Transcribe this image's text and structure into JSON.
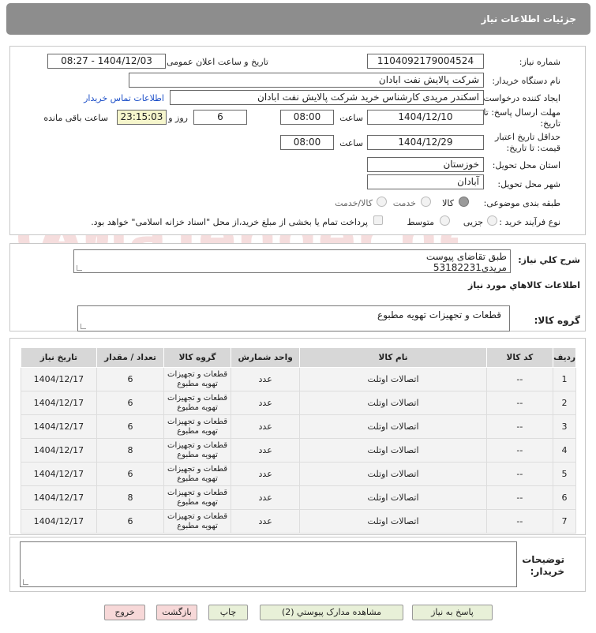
{
  "header": {
    "title": "جزئیات اطلاعات نیاز"
  },
  "form": {
    "need_number_label": "شماره نیاز:",
    "need_number": "1104092179004524",
    "announce_label": "تاریخ و ساعت اعلان عمومی:",
    "announce_value": "1404/12/03 - 08:27",
    "buyer_org_label": "نام دستگاه خریدار:",
    "buyer_org": "شرکت پالایش نفت ابادان",
    "creator_label": "ایجاد کننده درخواست:",
    "creator": "اسکندر مریدی کارشناس خرید شرکت پالایش نفت ابادان",
    "contact_link": "اطلاعات تماس خریدار",
    "deadline_label_1": "مهلت ارسال پاسخ: تا",
    "deadline_label_2": "تاریخ:",
    "deadline_date": "1404/12/10",
    "time_label": "ساعت",
    "deadline_time": "08:00",
    "days_value": "6",
    "days_label": "روز و",
    "remaining_time": "23:15:03",
    "remaining_label": "ساعت باقی مانده",
    "validity_label_1": "حداقل تاریخ اعتبار",
    "validity_label_2": "قیمت: تا تاریخ:",
    "validity_date": "1404/12/29",
    "validity_time": "08:00",
    "province_label": "استان محل تحویل:",
    "province": "خوزستان",
    "city_label": "شهر محل تحویل:",
    "city": "آبادان",
    "category_label": "طبقه بندی موضوعی:",
    "category_options": [
      "کالا",
      "خدمت",
      "کالا/خدمت"
    ],
    "category_selected": "کالا",
    "process_label": "نوع فرآیند خرید :",
    "process_options": [
      "جزیی",
      "متوسط"
    ],
    "payment_note": "پرداخت تمام یا بخشی از مبلغ خرید،از محل \"اسناد خزانه اسلامی\" خواهد بود."
  },
  "description": {
    "label": "شرح کلي نياز:",
    "line1": "طبق تقاضای پیوست",
    "line2": "مریدی53182231"
  },
  "goods": {
    "section_title": "اطلاعات کالاهاي مورد نياز",
    "group_label": "گروه کالا:",
    "group_value": "قطعات و تجهیزات تهویه مطبوع"
  },
  "table": {
    "headers": [
      "ردیف",
      "کد کالا",
      "نام کالا",
      "واحد شمارش",
      "گروه کالا",
      "تعداد / مقدار",
      "تاریخ نیاز"
    ],
    "rows": [
      {
        "n": "1",
        "code": "--",
        "name": "اتصالات اوتلت",
        "unit": "عدد",
        "group": "قطعات و تجهیزات تهویه مطبوع",
        "qty": "6",
        "date": "1404/12/17"
      },
      {
        "n": "2",
        "code": "--",
        "name": "اتصالات اوتلت",
        "unit": "عدد",
        "group": "قطعات و تجهیزات تهویه مطبوع",
        "qty": "6",
        "date": "1404/12/17"
      },
      {
        "n": "3",
        "code": "--",
        "name": "اتصالات اوتلت",
        "unit": "عدد",
        "group": "قطعات و تجهیزات تهویه مطبوع",
        "qty": "6",
        "date": "1404/12/17"
      },
      {
        "n": "4",
        "code": "--",
        "name": "اتصالات اوتلت",
        "unit": "عدد",
        "group": "قطعات و تجهیزات تهویه مطبوع",
        "qty": "8",
        "date": "1404/12/17"
      },
      {
        "n": "5",
        "code": "--",
        "name": "اتصالات اوتلت",
        "unit": "عدد",
        "group": "قطعات و تجهیزات تهویه مطبوع",
        "qty": "6",
        "date": "1404/12/17"
      },
      {
        "n": "6",
        "code": "--",
        "name": "اتصالات اوتلت",
        "unit": "عدد",
        "group": "قطعات و تجهیزات تهویه مطبوع",
        "qty": "8",
        "date": "1404/12/17"
      },
      {
        "n": "7",
        "code": "--",
        "name": "اتصالات اوتلت",
        "unit": "عدد",
        "group": "قطعات و تجهیزات تهویه مطبوع",
        "qty": "6",
        "date": "1404/12/17"
      }
    ]
  },
  "notes": {
    "label_1": "توضیحات",
    "label_2": "خریدار:"
  },
  "buttons": {
    "reply": "پاسخ به نیاز",
    "attachments": "مشاهده مدارک پیوستي (2)",
    "print": "چاپ",
    "back": "بازگشت",
    "exit": "خروج"
  },
  "watermark": {
    "text": "AriaTender.neT"
  },
  "colors": {
    "title_bg": "#8d8d8d",
    "link": "#1e50c8",
    "remaining_bg": "#f6f6cc",
    "button_green": "#e8f0d8",
    "button_pink": "#f7d8d8"
  }
}
